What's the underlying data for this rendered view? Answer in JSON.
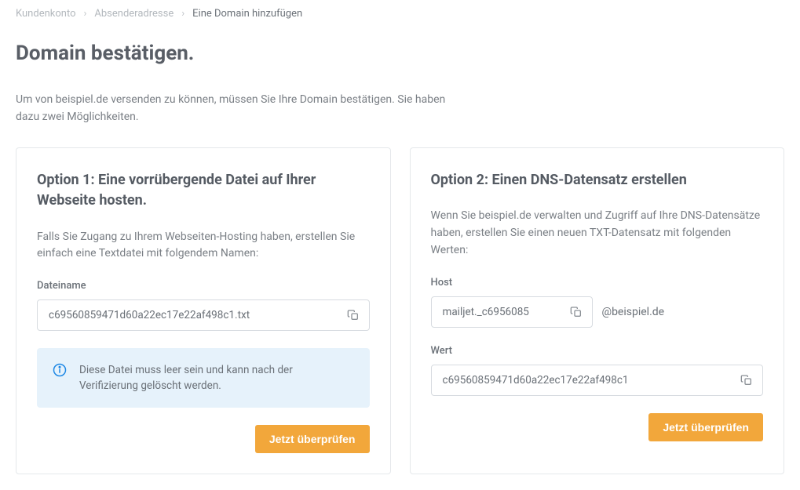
{
  "breadcrumbs": {
    "items": [
      "Kundenkonto",
      "Absenderadresse",
      "Eine Domain hinzufügen"
    ]
  },
  "page": {
    "title": "Domain bestätigen.",
    "description": "Um von beispiel.de versenden zu können, müssen Sie Ihre Domain bestätigen. Sie haben dazu zwei Möglichkeiten."
  },
  "option1": {
    "heading": "Option 1: Eine vorrübergende Datei auf Ihrer Webseite hosten.",
    "description": "Falls Sie Zugang zu Ihrem Webseiten-Hosting haben, erstellen Sie einfach eine Textdatei mit folgendem Namen:",
    "filename_label": "Dateiname",
    "filename_value": "c69560859471d60a22ec17e22af498c1.txt",
    "info_message": "Diese Datei muss leer sein und kann nach der Verifizierung gelöscht werden.",
    "verify_button": "Jetzt überprüfen"
  },
  "option2": {
    "heading": "Option 2: Einen DNS-Datensatz erstellen",
    "description": "Wenn Sie beispiel.de verwalten und Zugriff auf Ihre DNS-Datensätze haben, erstellen Sie einen neuen TXT-Datensatz mit folgenden Werten:",
    "host_label": "Host",
    "host_value": "mailjet._c6956085",
    "host_suffix": "@beispiel.de",
    "value_label": "Wert",
    "value_value": "c69560859471d60a22ec17e22af498c1",
    "verify_button": "Jetzt überprüfen"
  }
}
